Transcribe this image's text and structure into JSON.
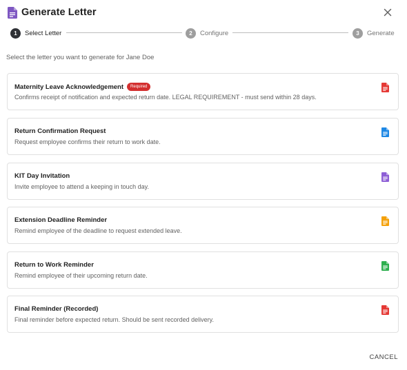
{
  "dialog": {
    "title": "Generate Letter",
    "title_icon": "document-icon",
    "title_icon_color": "#7e57c2",
    "close_icon": "close-icon"
  },
  "stepper": {
    "steps": [
      {
        "number": "1",
        "label": "Select Letter",
        "state": "active"
      },
      {
        "number": "2",
        "label": "Configure",
        "state": "inactive"
      },
      {
        "number": "3",
        "label": "Generate",
        "state": "inactive"
      }
    ]
  },
  "intro_text": "Select the letter you want to generate for Jane Doe",
  "letters": [
    {
      "title": "Maternity Leave Acknowledgement",
      "badge": "Required",
      "description": "Confirms receipt of notification and expected return date. LEGAL REQUIREMENT - must send within 28 days.",
      "icon": "document-icon",
      "icon_color": "#e53935"
    },
    {
      "title": "Return Confirmation Request",
      "description": "Request employee confirms their return to work date.",
      "icon": "document-icon",
      "icon_color": "#1e88e5"
    },
    {
      "title": "KIT Day Invitation",
      "description": "Invite employee to attend a keeping in touch day.",
      "icon": "document-icon",
      "icon_color": "#8e5fd6"
    },
    {
      "title": "Extension Deadline Reminder",
      "description": "Remind employee of the deadline to request extended leave.",
      "icon": "document-icon",
      "icon_color": "#f4a10b"
    },
    {
      "title": "Return to Work Reminder",
      "description": "Remind employee of their upcoming return date.",
      "icon": "document-icon",
      "icon_color": "#2eaf4f"
    },
    {
      "title": "Final Reminder (Recorded)",
      "description": "Final reminder before expected return. Should be sent recorded delivery.",
      "icon": "document-icon",
      "icon_color": "#e53935"
    }
  ],
  "actions": {
    "cancel_label": "CANCEL"
  }
}
